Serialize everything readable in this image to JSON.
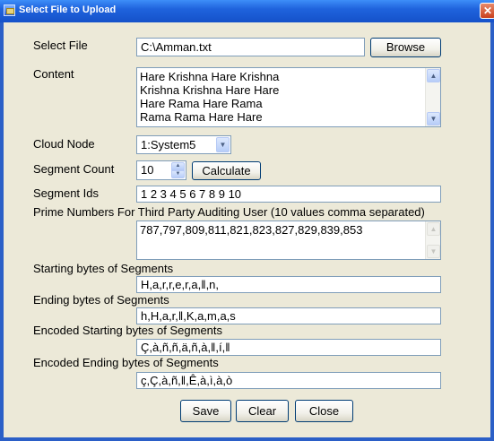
{
  "window": {
    "title": "Select File to Upload",
    "close_glyph": "✕",
    "colors": {
      "titlebar": "#1f63dd",
      "client_bg": "#ece9d8",
      "field_border": "#7f9db9",
      "frame": "#2b5fc7"
    }
  },
  "select_file": {
    "label": "Select File",
    "value": "C:\\Amman.txt",
    "browse_label": "Browse"
  },
  "content": {
    "label": "Content",
    "lines": [
      "Hare Krishna Hare Krishna",
      "Krishna Krishna Hare Hare",
      "Hare Rama Hare Rama",
      "Rama Rama Hare Hare"
    ]
  },
  "cloud_node": {
    "label": "Cloud Node",
    "selected": "1:System5"
  },
  "segment_count": {
    "label": "Segment Count",
    "value": "10",
    "calculate_label": "Calculate"
  },
  "segment_ids": {
    "label": "Segment Ids",
    "value": "1 2 3 4 5 6 7 8 9 10"
  },
  "prime_numbers": {
    "label": "Prime Numbers For Third Party Auditing User (10 values comma separated)",
    "value": "787,797,809,811,821,823,827,829,839,853"
  },
  "starting_bytes": {
    "label": "Starting bytes of Segments",
    "value": "H,a,r,r,e,r,a,‖,n,"
  },
  "ending_bytes": {
    "label": "Ending bytes of Segments",
    "value": "h,H,a,r,‖,K,a,m,a,s"
  },
  "encoded_starting": {
    "label": "Encoded Starting bytes of Segments",
    "value": "Ç,à,ñ,ñ,ä,ñ,à,‖,í,‖"
  },
  "encoded_ending": {
    "label": "Encoded Ending bytes of Segments",
    "value": "ç,Ç,à,ñ,‖,Ê,à,ì,à,ò"
  },
  "buttons": {
    "save": "Save",
    "clear": "Clear",
    "close": "Close"
  },
  "icons": {
    "scroll_up": "▲",
    "scroll_down": "▼",
    "combo": "▼",
    "spin_up": "▲",
    "spin_down": "▼"
  }
}
